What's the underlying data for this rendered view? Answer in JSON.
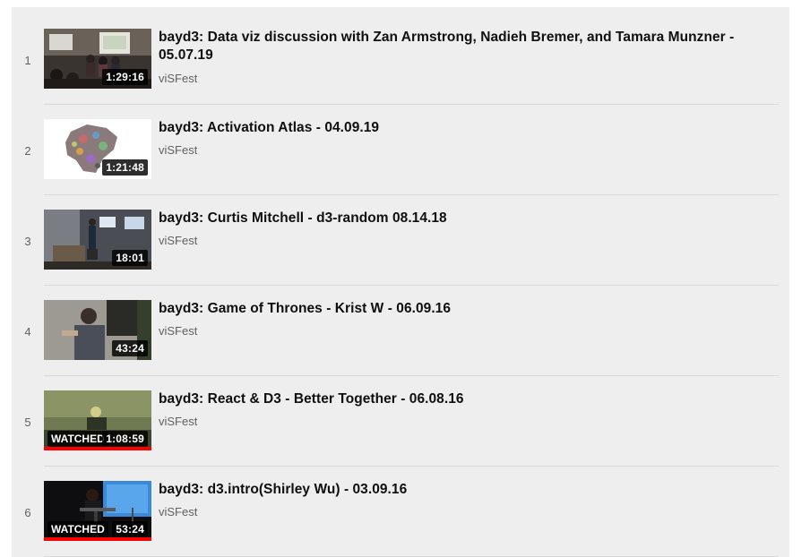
{
  "playlist": {
    "items": [
      {
        "index": "1",
        "title": "bayd3: Data viz discussion with Zan Armstrong, Nadieh Bremer, and Tamara Munzner - 05.07.19",
        "channel": "viSFest",
        "duration": "1:29:16",
        "watched_label": "",
        "progress": 0
      },
      {
        "index": "2",
        "title": "bayd3: Activation Atlas - 04.09.19",
        "channel": "viSFest",
        "duration": "1:21:48",
        "watched_label": "",
        "progress": 0
      },
      {
        "index": "3",
        "title": "bayd3: Curtis Mitchell - d3-random 08.14.18",
        "channel": "viSFest",
        "duration": "18:01",
        "watched_label": "",
        "progress": 0
      },
      {
        "index": "4",
        "title": "bayd3: Game of Thrones - Krist W - 06.09.16",
        "channel": "viSFest",
        "duration": "43:24",
        "watched_label": "",
        "progress": 0
      },
      {
        "index": "5",
        "title": "bayd3: React & D3 - Better Together - 06.08.16",
        "channel": "viSFest",
        "duration": "1:08:59",
        "watched_label": "WATCHED",
        "progress": 1.0
      },
      {
        "index": "6",
        "title": "bayd3: d3.intro(Shirley Wu) - 03.09.16",
        "channel": "viSFest",
        "duration": "53:24",
        "watched_label": "WATCHED",
        "progress": 1.0
      }
    ]
  },
  "colors": {
    "panel_bg": "#eeeeee",
    "progress_red": "#ff0000",
    "title_text": "#0f0f0f",
    "meta_text": "#606060"
  }
}
